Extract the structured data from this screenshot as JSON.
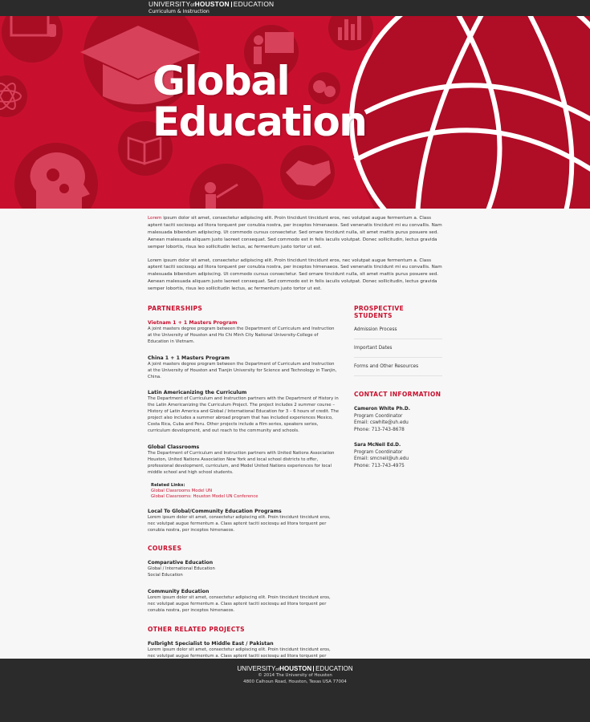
{
  "topbar": {
    "brand_university": "UNIVERSITY",
    "brand_of": "of",
    "brand_houston": "HOUSTON",
    "brand_college": "EDUCATION",
    "department": "Curriculum & Instruction"
  },
  "hero": {
    "title_line1": "Global",
    "title_line2": "Education",
    "background_color": "#c8102e",
    "icons": [
      "computer-icon",
      "graduation-cap-icon",
      "classroom-teacher-icon",
      "bar-chart-icon",
      "atom-icon",
      "book-icon",
      "head-gears-icon",
      "speech-bubbles-icon",
      "handshake-icon",
      "presenter-icon",
      "globe-icon"
    ]
  },
  "intro": {
    "p1_first_word": "Lorem",
    "p1_rest": " ipsum dolor sit amet, consectetur adipiscing elit. Proin tincidunt tincidunt eros, nec volutpat augue fermentum a. Class aptent taciti sociosqu ad litora torquent per conubia nostra, per inceptos himenaeos. Sed venenatis tincidunt mi eu convallis. Nam malesuada bibendum adipiscing. Ut commodo cursus consectetur. Sed ornare tincidunt nulla, sit amet mattis purus posuere sed. Aenean malesuada aliquam justo laoreet consequat. Sed commodo est in felis iaculis volutpat. Donec sollicitudin, lectus gravida semper lobortis, risus leo sollicitudin lectus, ac fermentum justo tortor ut est.",
    "p2": "Lorem ipsum dolor sit amet, consectetur adipiscing elit. Proin tincidunt tincidunt eros, nec volutpat augue fermentum a. Class aptent taciti sociosqu ad litora torquent per conubia nostra, per inceptos himenaeos. Sed venenatis tincidunt mi eu convallis. Nam malesuada bibendum adipiscing. Ut commodo cursus consectetur. Sed ornare tincidunt nulla, sit amet mattis purus posuere sed. Aenean malesuada aliquam justo laoreet consequat. Sed commodo est in felis iaculis volutpat. Donec sollicitudin, lectus gravida semper lobortis, risus leo sollicitudin lectus, ac fermentum justo tortor ut est."
  },
  "partnerships": {
    "heading": "PARTNERSHIPS",
    "items": [
      {
        "title": "Vietnam 1 + 1 Masters Program",
        "desc": "A joint masters degree program between the Department of Curriculum and Instruction at the University of Houston and Ho Chi Minh City National University-College of Education in Vietnam."
      },
      {
        "title": "China 1 + 1 Masters Program",
        "desc": "A joint masters degree program between the Department of Curriculum and Instruction at the University of Houston and Tianjin University for Science and Technology in Tianjin, China."
      },
      {
        "title": "Latin Americanizing the Curriculum",
        "desc": "The Department of Curriculum and Instruction partners with the Department of History in the Latin Americanizing the Curriculum Project. The project includes 2 summer course – History of Latin America and Global / International Education for 3 – 6 hours of credit. The project also includes a summer abroad program that has included experiences Mexico, Costa Rica, Cuba and Peru. Other projects include a film series, speakers series, curriculum development, and out reach to the community and schools."
      },
      {
        "title": "Global Classrooms",
        "desc": "The Department of Curriculum and Instruction partners with United Nations Association Houston, United Nations Association New York and local school districts to offer, professional development, curriculum, and Model United Nations experiences for local middle school and high school students."
      }
    ],
    "related_label": "Related Links:",
    "related_links": [
      "Global Classrooms Model UN",
      "Global Classrooms: Houston Model UN Conference"
    ],
    "local": {
      "title": "Local To Global/Community Education Programs",
      "desc": "Lorem ipsum dolor sit amet, consectetur adipiscing elit. Proin tincidunt tincidunt eros, nec volutpat augue fermentum a. Class aptent taciti sociosqu ad litora torquent per conubia nostra, per inceptos himenaeos."
    }
  },
  "courses": {
    "heading": "COURSES",
    "comparative": {
      "title": "Comparative Education",
      "line1": "Global / International Education",
      "line2": "Social Education"
    },
    "community": {
      "title": "Community Education",
      "desc": "Lorem ipsum dolor sit amet, consectetur adipiscing elit. Proin tincidunt tincidunt eros, nec volutpat augue fermentum a. Class aptent taciti sociosqu ad litora torquent per conubia nostra, per inceptos himenaeos."
    }
  },
  "other": {
    "heading": "OTHER RELATED PROJECTS",
    "fulbright": {
      "title": "Fulbright Specialist to Middle East / Pakistan",
      "desc": "Lorem ipsum dolor sit amet, consectetur adipiscing elit. Proin tincidunt tincidunt eros, nec volutpat augue fermentum a. Class aptent taciti sociosqu ad litora torquent per conubia nostra, per inceptos himenaeos."
    }
  },
  "prospective": {
    "heading": "PROSPECTIVE STUDENTS",
    "items": [
      "Admission Process",
      "Important Dates",
      "Forms and Other Resources"
    ]
  },
  "contact": {
    "heading": "CONTACT INFORMATION",
    "people": [
      {
        "name": "Cameron White Ph.D.",
        "role": "Program Coordinator",
        "email": "Email: cswhite@uh.edu",
        "phone": "Phone: 713-743-8678"
      },
      {
        "name": "Sara McNeil Ed.D.",
        "role": "Program Coordinator",
        "email": "Email: smcneil@uh.edu",
        "phone": "Phone: 713-743-4975"
      }
    ]
  },
  "footer": {
    "copyright": "© 2014 The University of Houston",
    "address": "4800 Calhoun Road, Houston, Texas USA 77004"
  },
  "colors": {
    "accent": "#c8102e",
    "bar": "#2b2b2b",
    "page": "#f7f7f7"
  }
}
